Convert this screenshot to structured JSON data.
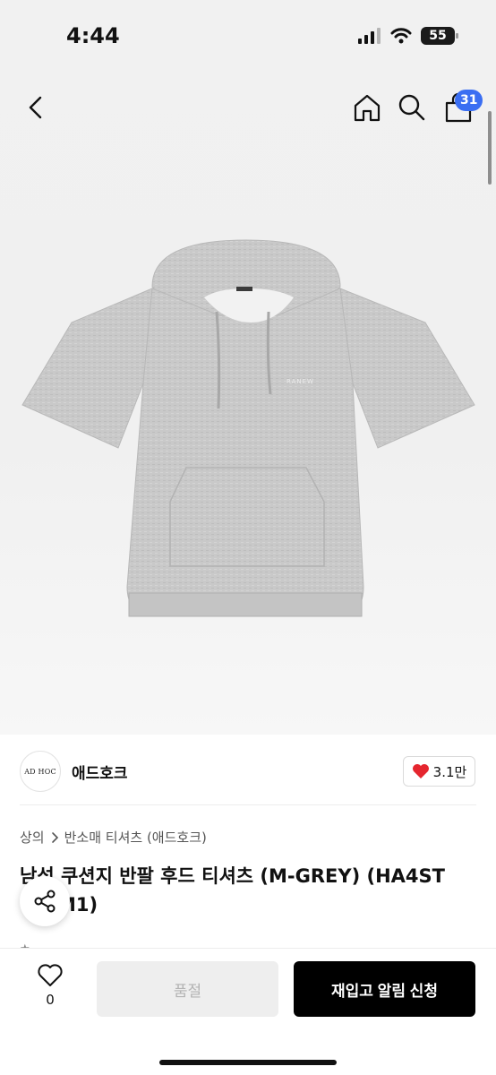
{
  "status_bar": {
    "time": "4:44",
    "battery": "55"
  },
  "nav": {
    "cart_badge": "31"
  },
  "product": {
    "image_logo_text": "RANEW",
    "tag_text": "AD HOC"
  },
  "brand": {
    "logo_text": "AD HOC",
    "name": "애드호크",
    "likes": "3.1만"
  },
  "breadcrumb": {
    "category": "상의",
    "subcategory": "반소매 티셔츠 (애드호크)"
  },
  "title": {
    "line1": "남성 쿠션지 반팔 후드 티셔츠 (M-GREY) (HA4ST",
    "line2": "M1)"
  },
  "bottom_bar": {
    "wish_count": "0",
    "soldout_label": "품절",
    "restock_label": "재입고 알림 신청"
  },
  "colors": {
    "accent": "#3a6ef2",
    "heart": "#e5262f",
    "primary_button": "#000000",
    "disabled_button": "#eeeeee"
  }
}
